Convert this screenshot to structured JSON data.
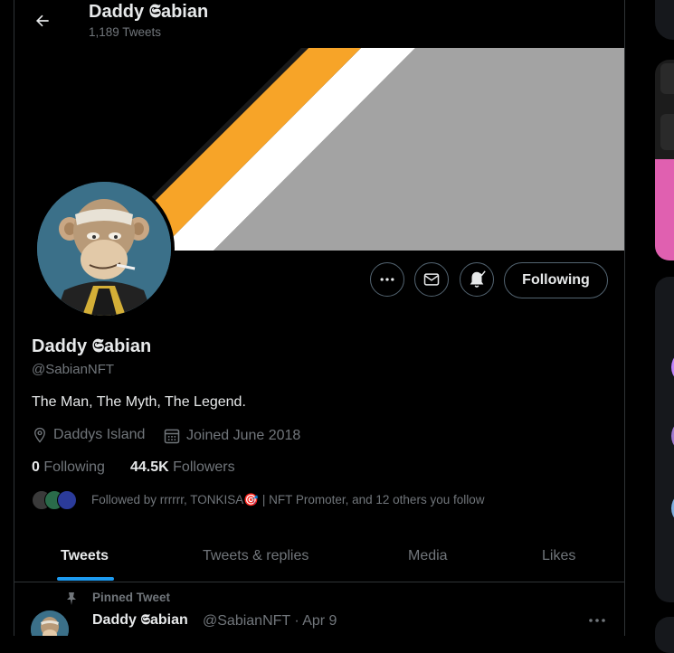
{
  "header": {
    "title": "Daddy 𝕾abian",
    "tweet_count": "1,189 Tweets"
  },
  "profile": {
    "name": "Daddy 𝕾abian",
    "handle": "@SabianNFT",
    "bio": "The Man, The Myth, The Legend.",
    "location": "Daddys Island",
    "joined": "Joined June 2018",
    "following_count": "0",
    "following_label": "Following",
    "followers_count": "44.5K",
    "followers_label": "Followers",
    "followed_by": "Followed by rrrrrr, TONKISA🎯 | NFT Promoter, and 12 others you follow"
  },
  "actions": {
    "following_button": "Following"
  },
  "tabs": [
    {
      "label": "Tweets",
      "active": true
    },
    {
      "label": "Tweets & replies",
      "active": false
    },
    {
      "label": "Media",
      "active": false
    },
    {
      "label": "Likes",
      "active": false
    }
  ],
  "pinned_tweet": {
    "label": "Pinned Tweet",
    "author_name": "Daddy 𝕾abian",
    "author_meta": "@SabianNFT · Apr 9"
  },
  "colors": {
    "accent": "#1d9bf0",
    "banner_orange": "#f7a428",
    "banner_gray": "#a3a3a3",
    "avatar_bg": "#3b7089",
    "right_card_pink": "#e060b0"
  },
  "icons": [
    "back-arrow-icon",
    "more-icon",
    "mail-icon",
    "bell-check-icon",
    "location-icon",
    "calendar-icon",
    "pin-icon"
  ]
}
